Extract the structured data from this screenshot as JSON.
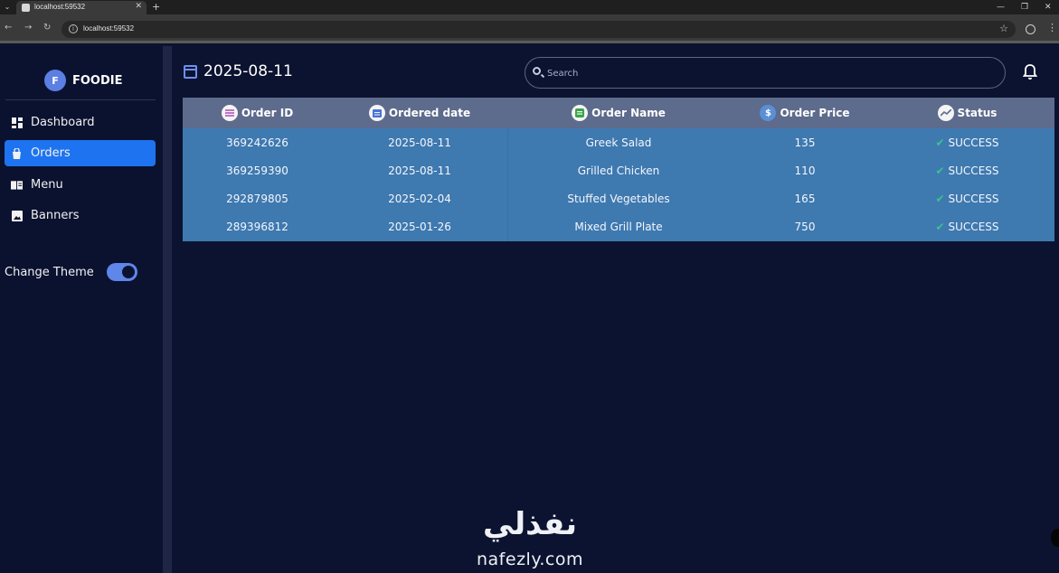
{
  "browser": {
    "tab_title": "localhost:59532",
    "url": "localhost:59532"
  },
  "brand": {
    "initial": "F",
    "name": "FOODIE"
  },
  "sidebar": {
    "items": [
      {
        "label": "Dashboard",
        "icon": "dashboard-icon",
        "active": false
      },
      {
        "label": "Orders",
        "icon": "orders-bag-icon",
        "active": true
      },
      {
        "label": "Menu",
        "icon": "menu-book-icon",
        "active": false
      },
      {
        "label": "Banners",
        "icon": "image-icon",
        "active": false
      }
    ],
    "theme_label": "Change Theme",
    "theme_toggle_on": true
  },
  "header": {
    "date": "2025-08-11",
    "search_placeholder": "Search"
  },
  "table": {
    "columns": [
      {
        "label": "Order ID",
        "icon": "list-icon"
      },
      {
        "label": "Ordered date",
        "icon": "calendar-icon"
      },
      {
        "label": "Order Name",
        "icon": "food-icon"
      },
      {
        "label": "Order Price",
        "icon": "dollar-icon"
      },
      {
        "label": "Status",
        "icon": "trending-icon"
      }
    ],
    "rows": [
      {
        "id": "369242626",
        "date": "2025-08-11",
        "name": "Greek Salad",
        "price": "135",
        "status": "SUCCESS"
      },
      {
        "id": "369259390",
        "date": "2025-08-11",
        "name": "Grilled Chicken",
        "price": "110",
        "status": "SUCCESS"
      },
      {
        "id": "292879805",
        "date": "2025-02-04",
        "name": "Stuffed Vegetables",
        "price": "165",
        "status": "SUCCESS"
      },
      {
        "id": "289396812",
        "date": "2025-01-26",
        "name": "Mixed Grill Plate",
        "price": "750",
        "status": "SUCCESS"
      }
    ]
  },
  "watermark": {
    "arabic": "نفذلي",
    "latin": "nafezly.com"
  },
  "colors": {
    "accent": "#1e74f0",
    "table_body": "#3e79b0",
    "table_head": "#5d6b8c",
    "success": "#39c58a",
    "background": "#0c1330"
  }
}
